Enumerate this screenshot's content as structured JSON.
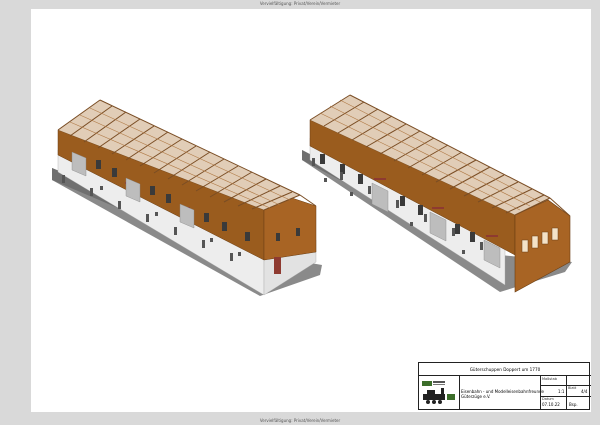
{
  "header_note": "Vervielfältigung: Privat/Verein/Vermieter",
  "footer_note": "Vervielfältigung: Privat/Verein/Vermieter",
  "title_block": {
    "title": "Güterschuppen Doppert um 1770",
    "org_line1": "Eisenbahn - und Modelleisenbahnfreunde",
    "org_line2": "Güterzüge e.V.",
    "label_scale_field": "Maßstab",
    "label_sheet_field": "Blatt",
    "label_date_field": "Datum",
    "scale": "1:1",
    "sheet": "4/4",
    "date": "07.10.22",
    "author": "Bsp.",
    "logo_text": "Vereinslogo"
  },
  "colors": {
    "wood": "#9a5c1e",
    "roof_frame": "#b07a46",
    "wall_white": "#ededed",
    "base_gray": "#8a8a8a",
    "window_dark": "#3a3a3a",
    "door_red": "#8e3a30"
  }
}
